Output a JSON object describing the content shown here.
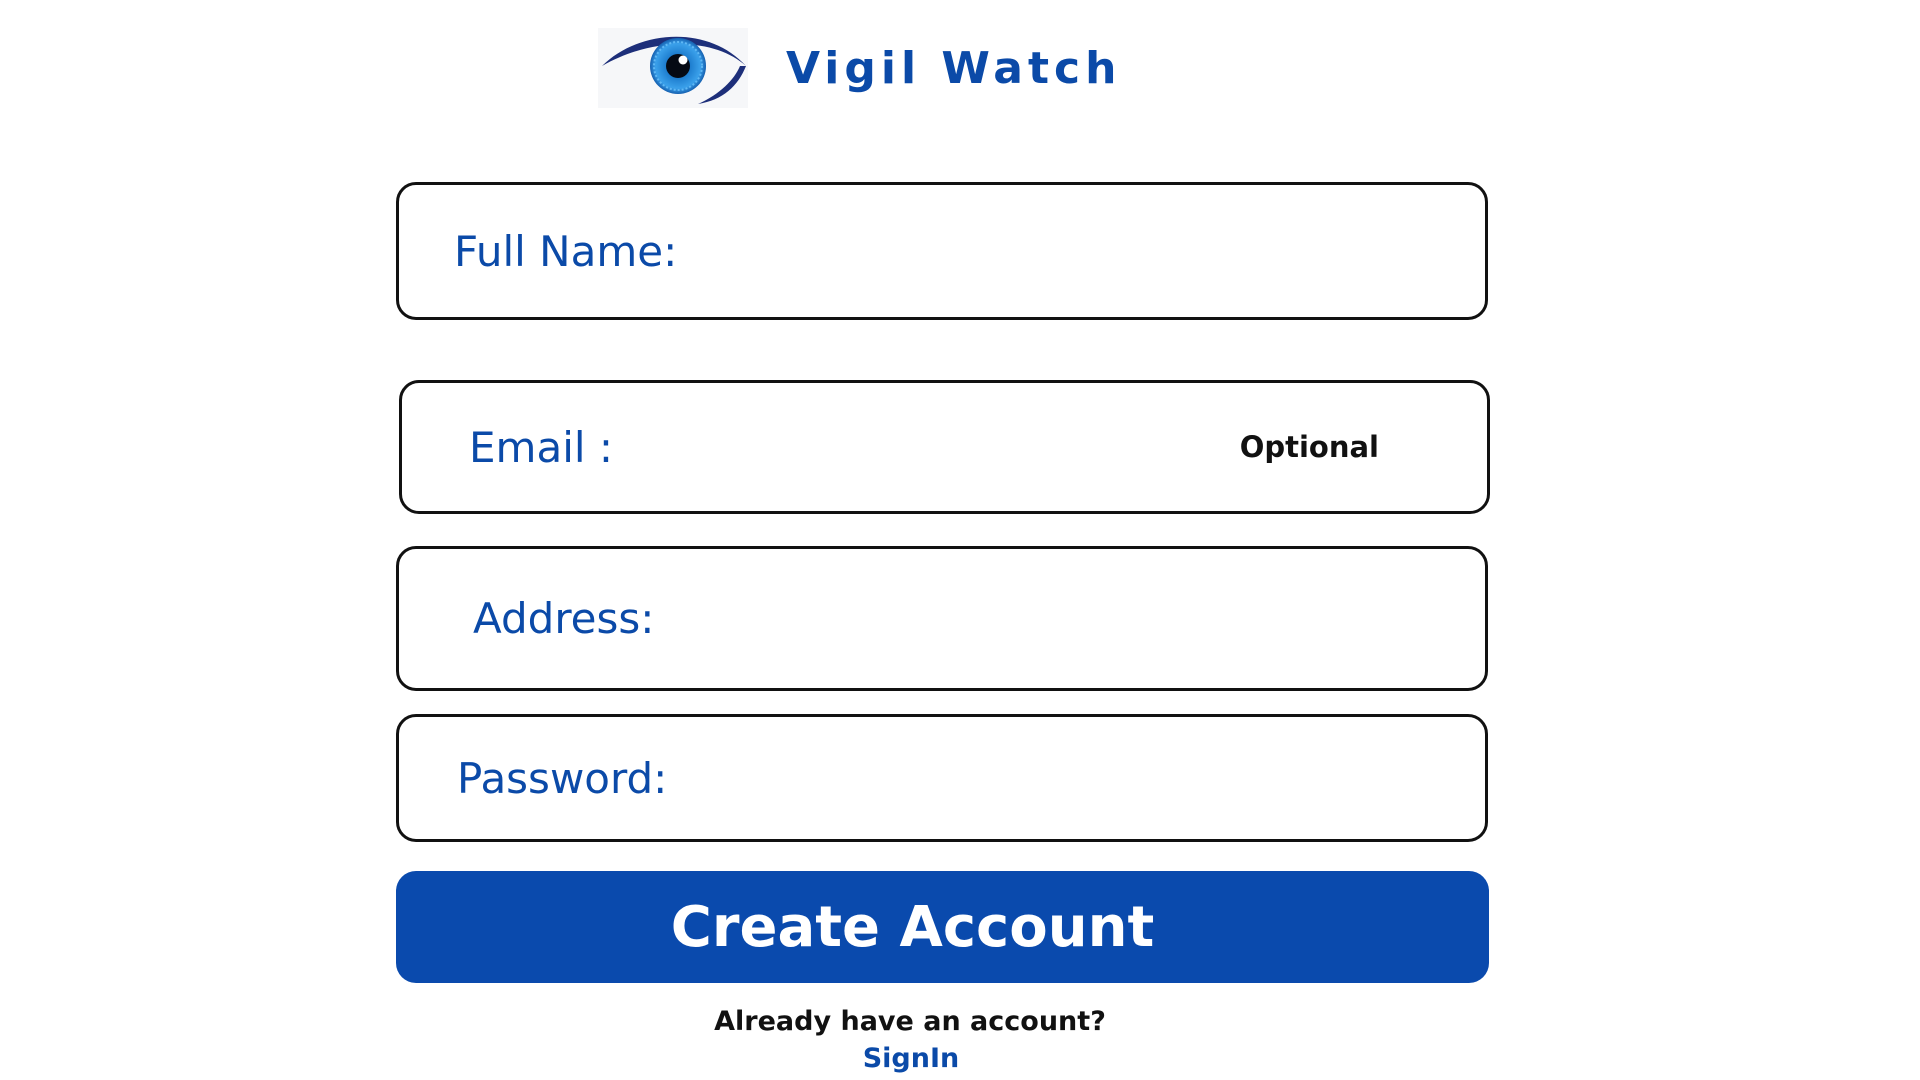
{
  "brand": {
    "name": "Vigil Watch",
    "logo_icon": "eye-icon",
    "color": "#0b4aa8"
  },
  "form": {
    "fields": [
      {
        "key": "full_name",
        "label": "Full Name:",
        "value": ""
      },
      {
        "key": "email",
        "label": "Email :",
        "value": "",
        "hint": "Optional"
      },
      {
        "key": "address",
        "label": "Address:",
        "value": ""
      },
      {
        "key": "password",
        "label": "Password:",
        "value": ""
      }
    ],
    "submit_label": "Create Account",
    "submit_color": "#0a4aad"
  },
  "footer": {
    "prompt": "Already have an account?",
    "signin_label": "SignIn"
  }
}
